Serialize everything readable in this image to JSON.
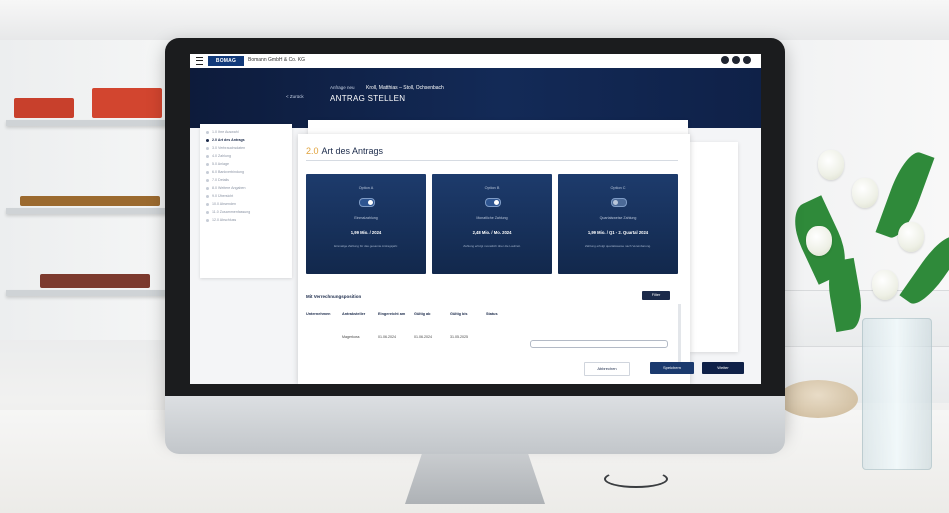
{
  "header": {
    "logo_text": "BOMAG",
    "company": "Bomann GmbH & Co. KG",
    "icons": [
      "bell-icon",
      "settings-icon",
      "user-icon"
    ]
  },
  "hero": {
    "back_label": "< Zurück",
    "breadcrumb": "Anfrage neu",
    "subtitle": "Kroll, Matthias – Stoll, Ochsenbach",
    "title": "ANTRAG STELLEN"
  },
  "steps": [
    {
      "label": "1.0 Ihre Auswahl",
      "active": false
    },
    {
      "label": "2.0 Art des Antrags",
      "active": true
    },
    {
      "label": "3.0 Verbrauchsdaten",
      "active": false
    },
    {
      "label": "4.0 Zahlung",
      "active": false
    },
    {
      "label": "5.0 Anlage",
      "active": false
    },
    {
      "label": "6.0 Bankverbindung",
      "active": false
    },
    {
      "label": "7.0 Details",
      "active": false
    },
    {
      "label": "8.0 Weitere Angaben",
      "active": false
    },
    {
      "label": "9.0 Übersicht",
      "active": false
    },
    {
      "label": "10.0 Absenden",
      "active": false
    },
    {
      "label": "11.0 Zusammenfassung",
      "active": false
    },
    {
      "label": "12.0 Abschluss",
      "active": false
    }
  ],
  "section": {
    "number": "2.0",
    "title": "Art des Antrags"
  },
  "options": [
    {
      "name": "Option A",
      "toggle": "on",
      "line1": "Einmalzahlung",
      "price": "1,99 Mio. / 2024",
      "note": "Einmalige Zahlung für das gesamte Antragsjahr."
    },
    {
      "name": "Option B",
      "toggle": "on",
      "line1": "Monatliche Zahlung",
      "price": "2,48 Mio. / Mo. 2024",
      "note": "Zahlung erfolgt monatlich über die Laufzeit."
    },
    {
      "name": "Option C",
      "toggle": "off",
      "line1": "Quartalsweise Zahlung",
      "price": "1,99 Mio. / Q1 - 2. Quartal 2024",
      "note": "Zahlung erfolgt quartalsweise nach Vereinbarung."
    }
  ],
  "table": {
    "title": "Mit Verrechnungsposition",
    "filter_label": "Filter",
    "headers": [
      "Unternehmen",
      "Antraksteller",
      "Eingereicht am",
      "Gültig ab",
      "Gültig bis",
      "Status"
    ],
    "row": [
      "",
      "Magerkoss",
      "01.06.2024",
      "01.06.2024",
      "31.05.2025",
      ""
    ]
  },
  "footer": {
    "cancel_label": "Abbrechen",
    "save_label": "Speichern",
    "next_label": "Weiter"
  }
}
